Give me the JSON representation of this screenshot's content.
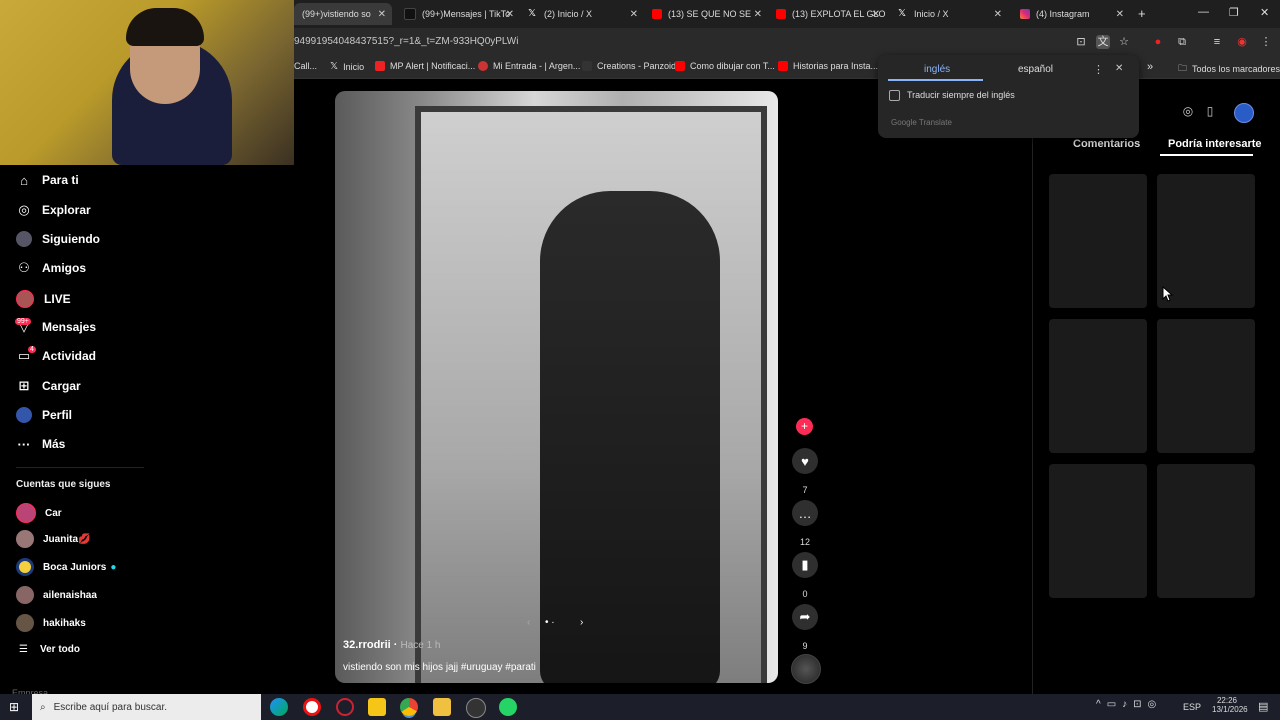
{
  "browser": {
    "tabs": [
      {
        "label": "(99+)vistiendo so",
        "close": "✕"
      },
      {
        "label": "(99+)Mensajes | TikTo",
        "close": "✕"
      },
      {
        "label": "(2) Inicio / X",
        "close": "✕"
      },
      {
        "label": "(13) SE QUE NO SE",
        "close": "✕"
      },
      {
        "label": "(13) EXPLOTA EL GLO",
        "close": "✕"
      },
      {
        "label": "Inicio / X",
        "close": "✕"
      },
      {
        "label": "(4) Instagram",
        "close": "✕"
      }
    ],
    "new_tab": "+",
    "url": "94991954048437515?_r=1&_t=ZM-933HQ0yPLWi",
    "bookmarks": [
      {
        "label": "Call..."
      },
      {
        "label": "Inicio"
      },
      {
        "label": "MP Alert | Notificaci..."
      },
      {
        "label": "Mi Entrada - | Argen..."
      },
      {
        "label": "Creations - Panzoid"
      },
      {
        "label": "Como dibujar con T..."
      },
      {
        "label": "Historias para Insta..."
      }
    ],
    "bookmarks_more": "»",
    "all_bookmarks": "Todos los marcadores"
  },
  "translate_popup": {
    "lang_from": "inglés",
    "lang_to": "español",
    "checkbox_label": "Traducir siempre del inglés",
    "footer": "Google Translate",
    "menu": "⋮",
    "close": "✕"
  },
  "sidebar": {
    "nav": [
      {
        "label": "Para ti"
      },
      {
        "label": "Explorar"
      },
      {
        "label": "Siguiendo"
      },
      {
        "label": "Amigos"
      },
      {
        "label": "LIVE"
      },
      {
        "label": "Mensajes",
        "badge": "99+"
      },
      {
        "label": "Actividad",
        "badge": "4"
      },
      {
        "label": "Cargar"
      },
      {
        "label": "Perfil"
      },
      {
        "label": "Más"
      }
    ],
    "following_heading": "Cuentas que sigues",
    "following": [
      {
        "label": "Car"
      },
      {
        "label": "Juanita💋"
      },
      {
        "label": "Boca Juniors"
      },
      {
        "label": "ailenaishaa"
      },
      {
        "label": "hakihaks"
      }
    ],
    "see_all": "Ver todo",
    "cut_text": "Empresa"
  },
  "video": {
    "username": "32.rrodrii",
    "time": "Hace 1 h",
    "caption": "vistiendo son mis hijos jajj #uruguay #parati"
  },
  "actions": {
    "likes": "7",
    "comments": "12",
    "saves": "0",
    "shares": "9"
  },
  "right_panel": {
    "tab_comments": "Comentarios",
    "tab_interest": "Podría interesarte"
  },
  "taskbar": {
    "search_placeholder": "Escribe aquí para buscar.",
    "lang": "ESP",
    "time": "22:26",
    "date": "13/1/2026"
  }
}
